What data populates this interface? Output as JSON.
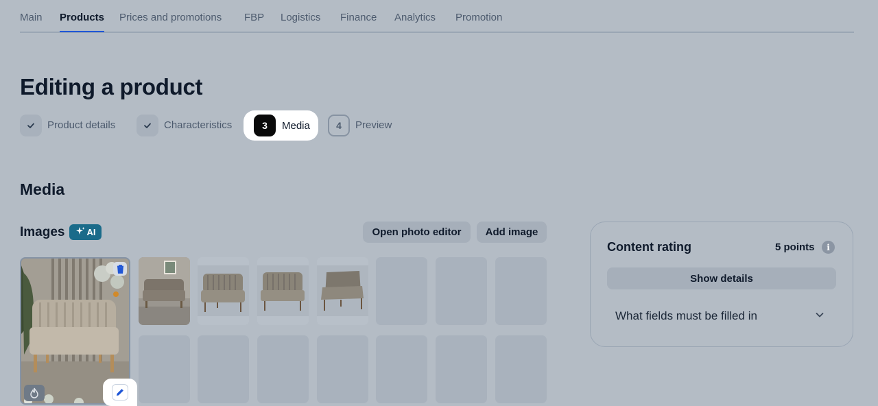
{
  "nav": {
    "tabs": [
      {
        "label": "Main"
      },
      {
        "label": "Products"
      },
      {
        "label": "Prices and promotions"
      },
      {
        "label": "FBP"
      },
      {
        "label": "Logistics"
      },
      {
        "label": "Finance"
      },
      {
        "label": "Analytics"
      },
      {
        "label": "Promotion"
      }
    ],
    "active": "Products"
  },
  "page": {
    "title": "Editing a product"
  },
  "stepper": {
    "steps": [
      {
        "label": "Product details",
        "state": "done"
      },
      {
        "label": "Characteristics",
        "state": "done"
      },
      {
        "number": "3",
        "label": "Media",
        "state": "current"
      },
      {
        "number": "4",
        "label": "Preview",
        "state": "todo"
      }
    ]
  },
  "media": {
    "title": "Media",
    "images_label": "Images",
    "ai_badge": "AI",
    "open_editor_label": "Open photo editor",
    "add_image_label": "Add image",
    "thumbnails_filled": 4,
    "thumbnails_empty": 3,
    "empty_slots_second_row": 7
  },
  "rating": {
    "title": "Content rating",
    "points": "5 points",
    "info_icon": "i",
    "show_details_label": "Show details",
    "fields_label": "What fields must be filled in"
  },
  "colors": {
    "overlay_bg": "#b4bcc5",
    "accent": "#1f56d6",
    "ai_badge": "#1a6b8a"
  }
}
